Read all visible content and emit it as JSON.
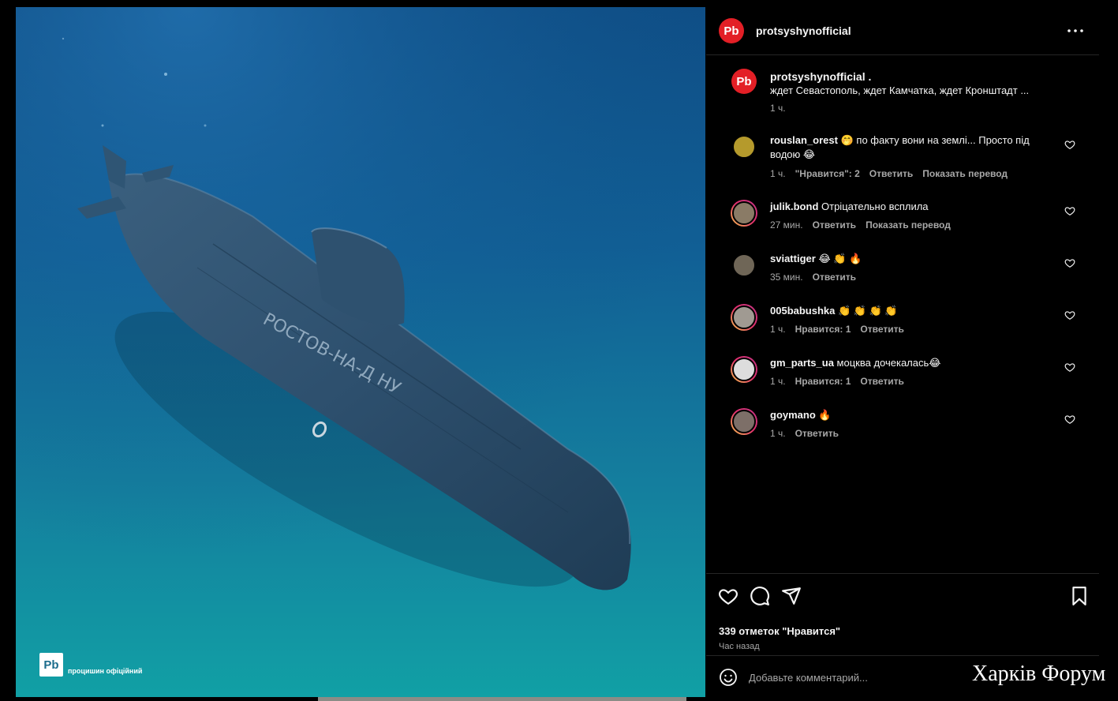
{
  "post": {
    "account": "protsyshynofficial",
    "brand_logo": "Pb",
    "media_watermark": "процишин офіційний",
    "caption_user": "protsyshynofficial .",
    "caption_text": "ждет Севастополь, ждет Камчатка, ждет Кронштадт ...",
    "caption_time": "1 ч.",
    "hull_text": "РОСТОВ-НА-Д НУ",
    "likes": "339 отметок \"Нравится\"",
    "time": "Час назад",
    "comment_placeholder": "Добавьте комментарий..."
  },
  "comments": [
    {
      "user": "rouslan_orest",
      "text": "🤭 по факту вони на землі... Просто під водою 😂",
      "time": "1 ч.",
      "likes": "\"Нравится\": 2",
      "reply": "Ответить",
      "translate": "Показать перевод",
      "avatar_color": "#b59a2c"
    },
    {
      "user": "julik.bond",
      "text": "Отріцательно всплила",
      "time": "27 мин.",
      "likes": "",
      "reply": "Ответить",
      "translate": "Показать перевод",
      "avatar_color": "#8a7b66"
    },
    {
      "user": "sviattiger",
      "text": "😂 👏 🔥",
      "time": "35 мин.",
      "likes": "",
      "reply": "Ответить",
      "translate": "",
      "avatar_color": "#6f6657"
    },
    {
      "user": "005babushka",
      "text": "👏 👏 👏 👏",
      "time": "1 ч.",
      "likes": "Нравится: 1",
      "reply": "Ответить",
      "translate": "",
      "avatar_color": "#a09a92"
    },
    {
      "user": "gm_parts_ua",
      "text": "моцква дочекалась😂",
      "time": "1 ч.",
      "likes": "Нравится: 1",
      "reply": "Ответить",
      "translate": "",
      "avatar_color": "#dddddd"
    },
    {
      "user": "goymano",
      "text": "🔥",
      "time": "1 ч.",
      "likes": "",
      "reply": "Ответить",
      "translate": "",
      "avatar_color": "#7d6f68"
    }
  ],
  "forum_watermark": "Харків Форум",
  "colors": {
    "brand_red": "#e31f26",
    "background": "#000000",
    "secondary_text": "#a8a8a8",
    "divider": "#262626"
  },
  "icons": [
    "more-icon",
    "heart-icon",
    "comment-icon",
    "share-icon",
    "bookmark-icon",
    "emoji-icon"
  ]
}
